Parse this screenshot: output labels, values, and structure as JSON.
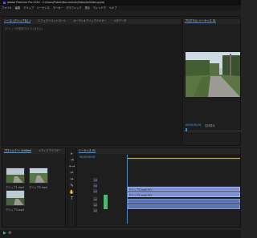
{
  "app": {
    "title": "Adobe Premiere Pro 2020 - C:\\Users\\Public\\Documents\\Video\\Untitled.prproj",
    "menu": [
      "ファイル",
      "編集",
      "クリップ",
      "シーケンス",
      "マーカー",
      "グラフィック",
      "表示",
      "ウィンドウ",
      "ヘルプ"
    ]
  },
  "source": {
    "tabs": [
      "ソース: (クリップなし)",
      "エフェクトコントロール",
      "オーディオクリップミキサー",
      "メタデータ"
    ],
    "message": "(クリップが選択されていません)"
  },
  "program": {
    "tab": "プログラム: シーケンス 01",
    "timecode": "00;00;00;00",
    "fit_label": "全体表示"
  },
  "project": {
    "tabs": [
      "プロジェクト: Untitled",
      "メディアブラウザー"
    ],
    "clips": [
      {
        "name": "クリップ1.mp4"
      },
      {
        "name": "クリップ2.mp4"
      },
      {
        "name": "クリップ3.mp4"
      }
    ]
  },
  "timeline": {
    "tab": "シーケンス 01",
    "timecode": "00;00;00;00",
    "video_tracks": [
      "V3",
      "V2",
      "V1"
    ],
    "audio_tracks": [
      "A1",
      "A2",
      "A3"
    ],
    "clip_label_v": "クリップ1.mp4 [V]",
    "clip_label_v2": "クリップ2.mp4 [V]"
  },
  "colors": {
    "accent": "#2d8ceb",
    "timecode": "#5aa7ff",
    "video_clip": "#7c8fd6",
    "audio_clip": "#5a73b6",
    "playhead": "#2d8ceb",
    "green_clip": "#3fbf6f"
  },
  "icons": [
    "selection-tool-icon",
    "track-select-icon",
    "ripple-edit-icon",
    "razor-icon",
    "slip-icon",
    "pen-icon",
    "hand-icon",
    "type-icon",
    "play-icon",
    "wrench-icon"
  ]
}
